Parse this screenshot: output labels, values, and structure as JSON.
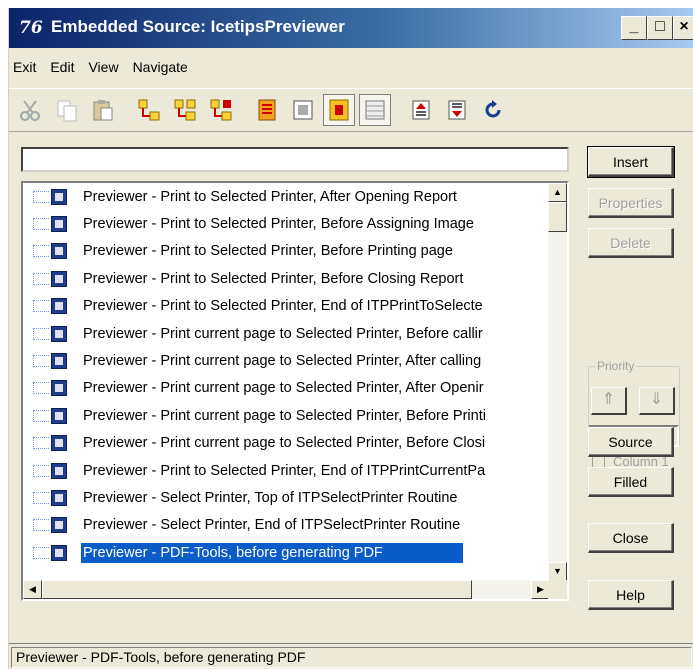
{
  "window": {
    "title": "Embedded Source: IcetipsPreviewer",
    "app_icon_text": "76",
    "min_symbol": "_",
    "max_symbol": "□",
    "close_symbol": "×"
  },
  "menu": {
    "exit": "Exit",
    "edit": "Edit",
    "view": "View",
    "navigate": "Navigate"
  },
  "toolbar": {
    "icons": [
      "cut-icon",
      "copy-icon",
      "paste-icon",
      "tree-expand-icon",
      "tree-collapse-icon",
      "tree-filled-icon",
      "list-icon",
      "embed-icon",
      "filled-icon",
      "grid-icon",
      "previous-icon",
      "next-icon",
      "refresh-icon"
    ]
  },
  "filter": {
    "value": "",
    "placeholder": ""
  },
  "tree": {
    "rows": [
      "Previewer - Print to Selected Printer, After Opening Report",
      "Previewer - Print to Selected Printer, Before Assigning Image",
      "Previewer - Print to Selected Printer, Before Printing page",
      "Previewer - Print to Selected Printer, Before Closing Report",
      "Previewer - Print to Selected Printer, End of ITPPrintToSelecte",
      "Previewer - Print current page to Selected Printer, Before callir",
      "Previewer - Print current page to Selected Printer, After calling",
      "Previewer - Print current page to Selected Printer, After Openir",
      "Previewer - Print current page to Selected Printer, Before Printi",
      "Previewer - Print current page to Selected Printer, Before Closi",
      "Previewer - Print to Selected Printer, End of ITPPrintCurrentPa",
      "Previewer - Select Printer, Top of ITPSelectPrinter Routine",
      "Previewer - Select Printer, End of ITPSelectPrinter Routine",
      "Previewer - PDF-Tools, before generating PDF"
    ],
    "selected_index": 13
  },
  "buttons": {
    "insert": "Insert",
    "properties": "Properties",
    "delete": "Delete",
    "priority_label": "Priority",
    "up_arrow": "⇑",
    "down_arrow": "⇓",
    "column1": "Column 1",
    "source": "Source",
    "filled": "Filled",
    "close": "Close",
    "help": "Help"
  },
  "status": {
    "text": "Previewer - PDF-Tools, before generating PDF"
  }
}
